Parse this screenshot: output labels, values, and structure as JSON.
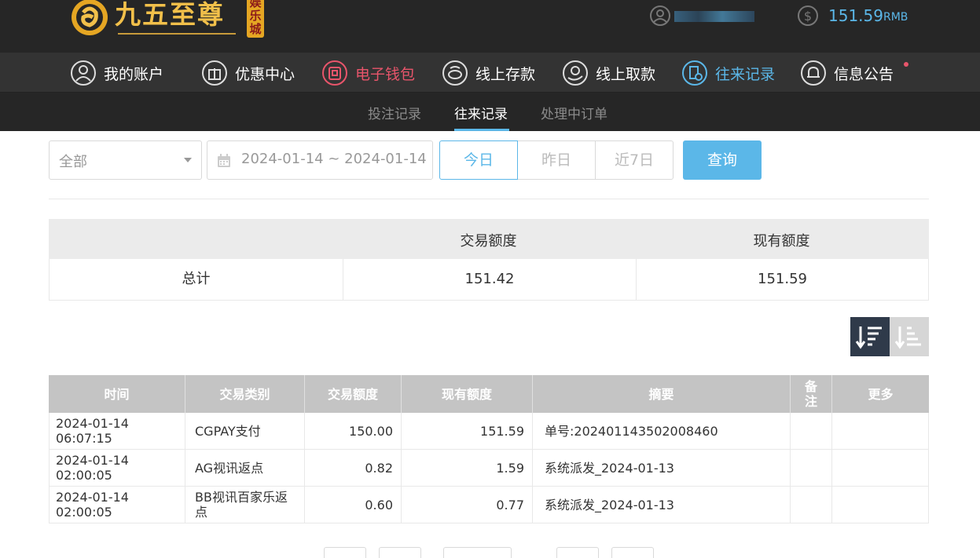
{
  "header": {
    "logo_text": "九五至尊",
    "logo_badge": "娱乐城",
    "balance": "151.59",
    "balance_unit": "RMB"
  },
  "nav": {
    "items": [
      {
        "label": "我的账户",
        "icon": "user-circle-icon"
      },
      {
        "label": "优惠中心",
        "icon": "gift-icon"
      },
      {
        "label": "电子钱包",
        "icon": "wallet-icon"
      },
      {
        "label": "线上存款",
        "icon": "deposit-icon"
      },
      {
        "label": "线上取款",
        "icon": "withdraw-icon"
      },
      {
        "label": "往来记录",
        "icon": "record-icon"
      },
      {
        "label": "信息公告",
        "icon": "bell-icon"
      }
    ]
  },
  "subtabs": {
    "bets": "投注记录",
    "transactions": "往来记录",
    "pending": "处理中订单"
  },
  "filters": {
    "category": "全部",
    "date_range": "2024-01-14 ~ 2024-01-14",
    "today": "今日",
    "yesterday": "昨日",
    "last7": "近7日",
    "query": "查询"
  },
  "summary": {
    "headers": [
      "",
      "交易额度",
      "现有额度"
    ],
    "label": "总计",
    "amount": "151.42",
    "balance": "151.59"
  },
  "records": {
    "headers": {
      "time": "时间",
      "type": "交易类别",
      "amount": "交易额度",
      "balance": "现有额度",
      "summary": "摘要",
      "note": "备注",
      "more": "更多"
    },
    "rows": [
      {
        "time": "2024-01-14 06:07:15",
        "type": "CGPAY支付",
        "amount": "150.00",
        "balance": "151.59",
        "summary": "单号:202401143502008460",
        "note": "",
        "more": ""
      },
      {
        "time": "2024-01-14 02:00:05",
        "type": "AG视讯返点",
        "amount": "0.82",
        "balance": "1.59",
        "summary": "系统派发_2024-01-13",
        "note": "",
        "more": ""
      },
      {
        "time": "2024-01-14 02:00:05",
        "type": "BB视讯百家乐返点",
        "amount": "0.60",
        "balance": "0.77",
        "summary": "系统派发_2024-01-13",
        "note": "",
        "more": ""
      }
    ]
  },
  "colors": {
    "accent": "#5bb7e8",
    "wallet": "#e8556b",
    "topbar": "#262626",
    "navbar": "#333333",
    "table_header": "#c4c4c4"
  }
}
